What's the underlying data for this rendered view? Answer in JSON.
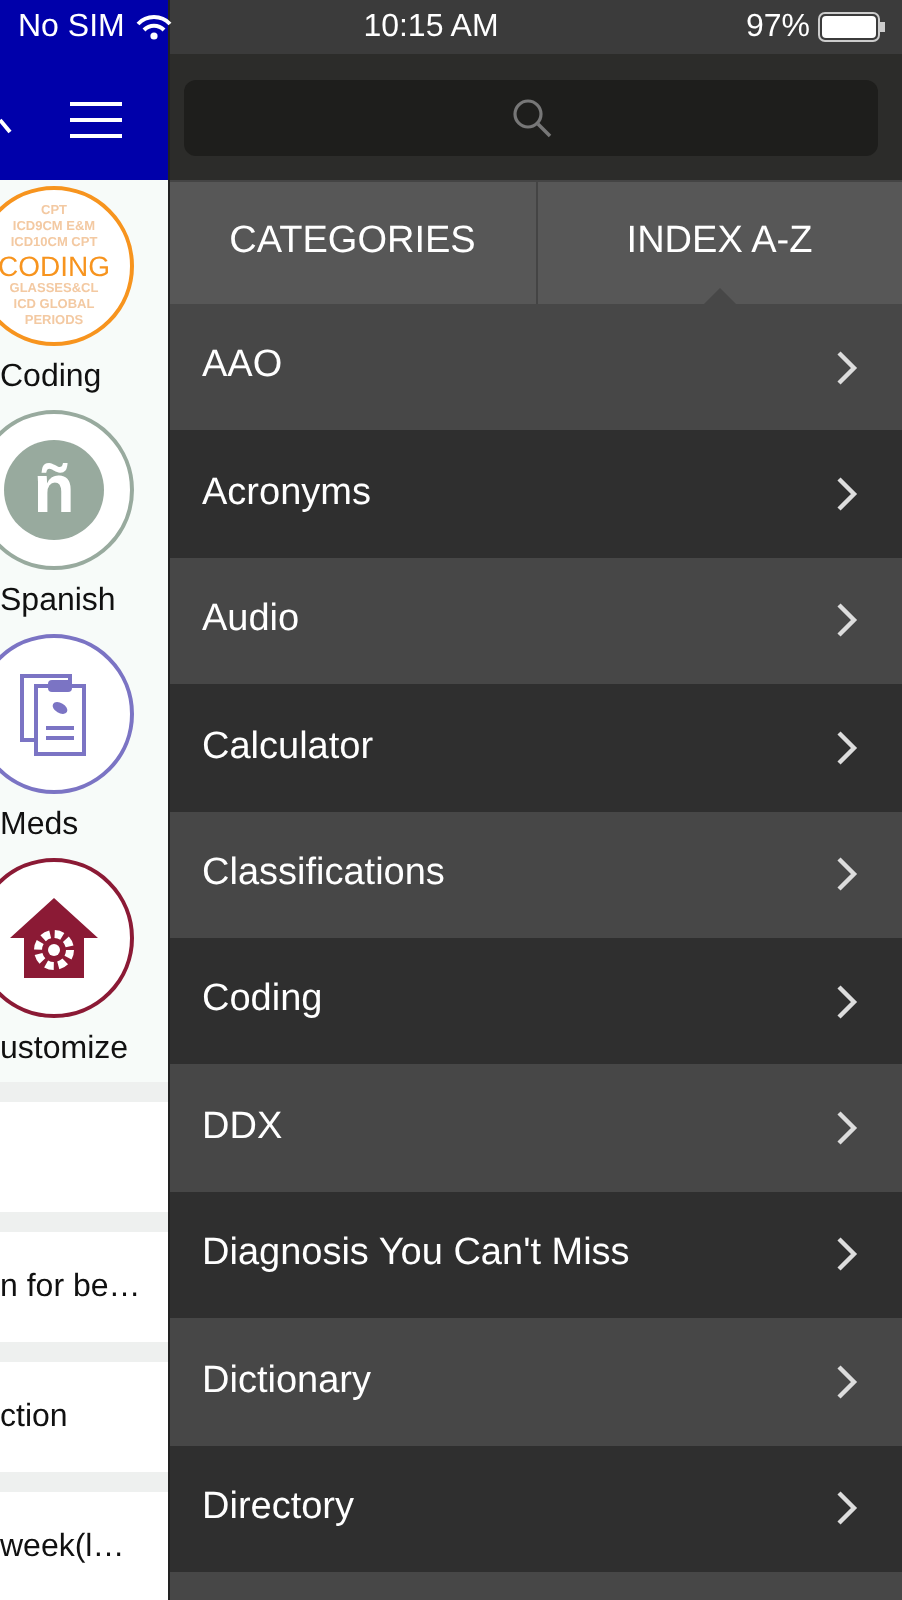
{
  "status_bar": {
    "carrier": "No SIM",
    "time": "10:15 AM",
    "battery": "97%"
  },
  "side_menu": {
    "shortcuts": [
      {
        "kind": "coding",
        "label": "Coding",
        "logo_lines": [
          "CPT",
          "ICD9CM E&M",
          "ICD10CM CPT",
          "CODING",
          "GLASSES&CL",
          "ICD GLOBAL",
          "PERIODS"
        ]
      },
      {
        "kind": "spanish",
        "label": "Spanish",
        "glyph": "ñ"
      },
      {
        "kind": "meds",
        "label": "Meds"
      },
      {
        "kind": "customize",
        "label": "ustomize"
      }
    ],
    "items": [
      "n for be…",
      "ction",
      "week(l…"
    ]
  },
  "tabs": [
    {
      "label": "CATEGORIES",
      "selected": false
    },
    {
      "label": "INDEX A-Z",
      "selected": true
    }
  ],
  "index_items": [
    "AAO",
    "Acronyms",
    "Audio",
    "Calculator",
    "Classifications",
    "Coding",
    "DDX",
    "Diagnosis You Can't Miss",
    "Dictionary",
    "Directory"
  ]
}
